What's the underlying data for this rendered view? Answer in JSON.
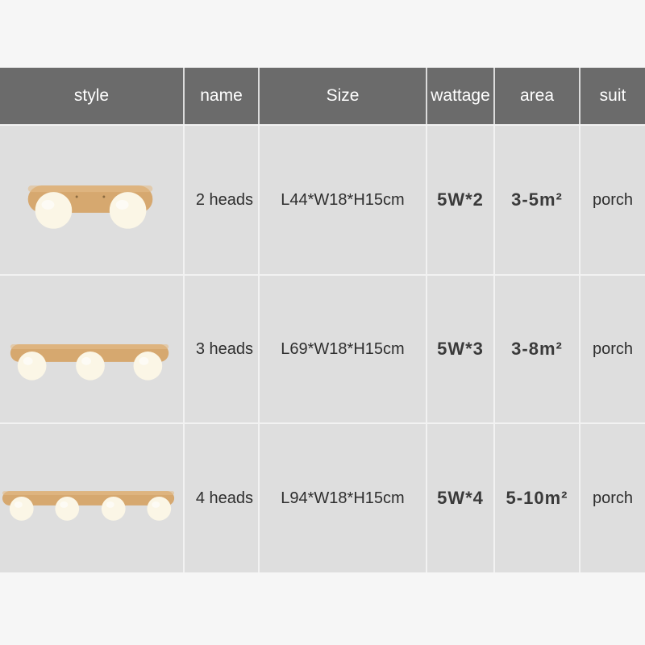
{
  "headers": [
    "style",
    "name",
    "Size",
    "wattage",
    "area",
    "suit"
  ],
  "rows": [
    {
      "name": "2 heads",
      "size": "L44*W18*H15cm",
      "wattage": "5W*2",
      "area": "3-5m²",
      "suit": "porch",
      "lamp_heads": 2
    },
    {
      "name": "3 heads",
      "size": "L69*W18*H15cm",
      "wattage": "5W*3",
      "area": "3-8m²",
      "suit": "porch",
      "lamp_heads": 3
    },
    {
      "name": "4 heads",
      "size": "L94*W18*H15cm",
      "wattage": "5W*4",
      "area": "5-10m²",
      "suit": "porch",
      "lamp_heads": 4
    }
  ],
  "colors": {
    "header_bg": "#6b6b6b",
    "row_bg": "#dedede",
    "wood": "#d4a66e",
    "globe": "#fbf6e8"
  }
}
